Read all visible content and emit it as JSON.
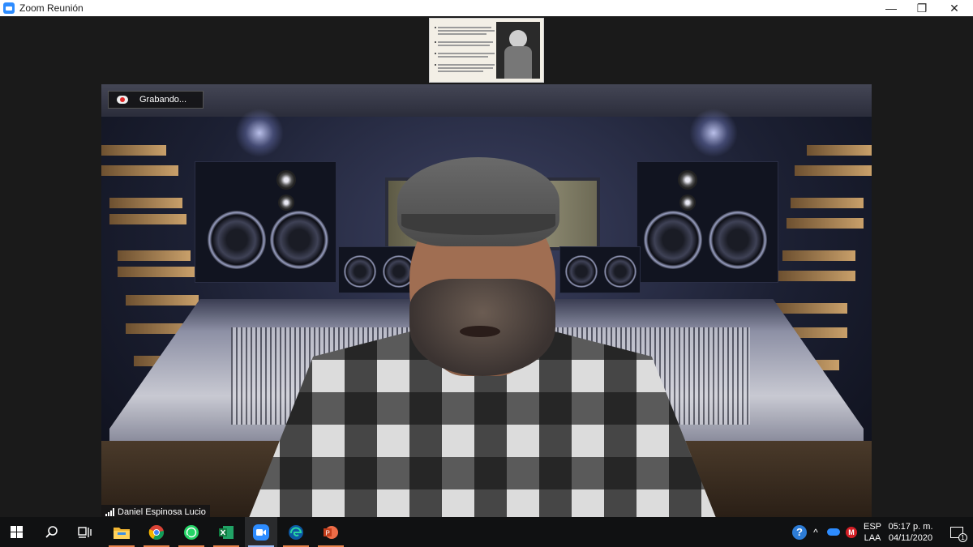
{
  "window": {
    "title": "Zoom Reunión",
    "icon": "zoom-app-icon",
    "minimize_glyph": "—",
    "maximize_glyph": "❐",
    "close_glyph": "✕"
  },
  "meeting": {
    "recording_label": "Grabando...",
    "participant_name": "Daniel Espinosa Lucio"
  },
  "taskbar": {
    "apps": [
      "start",
      "search",
      "task-view",
      "file-explorer",
      "chrome",
      "whatsapp",
      "excel",
      "zoom",
      "edge",
      "powerpoint"
    ],
    "language_top": "ESP",
    "language_bottom": "LAA",
    "time": "05:17 p. m.",
    "date": "04/11/2020",
    "notification_count": "1",
    "help_glyph": "?",
    "tray_arrow_glyph": "^"
  },
  "colors": {
    "zoom_blue": "#2d8cff",
    "recording_red": "#e02828",
    "taskbar_bg": "#101112",
    "stage_bg": "#1a1a1a"
  }
}
